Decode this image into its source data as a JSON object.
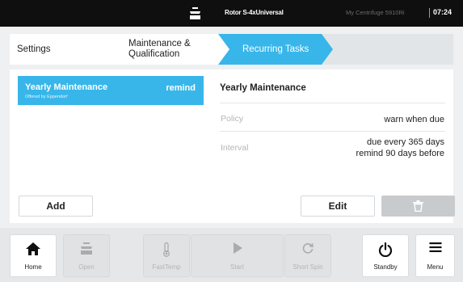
{
  "status_bar": {
    "icon": "rotor-icon",
    "rotor": "Rotor S-4xUniversal",
    "device": "My Centrifuge 5910Ri",
    "time": "07:24"
  },
  "breadcrumb": [
    {
      "label": "Settings"
    },
    {
      "label": "Maintenance &\nQualification"
    },
    {
      "label": "Recurring Tasks"
    }
  ],
  "task_list": {
    "items": [
      {
        "name": "Yearly Maintenance",
        "sub": "Offered by Eppendorf",
        "status": "remind"
      }
    ],
    "add_label": "Add"
  },
  "detail": {
    "title": "Yearly Maintenance",
    "rows": [
      {
        "label": "Policy",
        "value": "warn when due"
      },
      {
        "label": "Interval",
        "value": "due every 365 days\nremind 90 days before"
      }
    ],
    "edit_label": "Edit",
    "delete_icon": "trash-icon"
  },
  "nav": [
    {
      "label": "Home",
      "icon": "home-icon",
      "enabled": true
    },
    {
      "label": "Open",
      "icon": "open-lid-icon",
      "enabled": false
    },
    {
      "label": "FastTemp",
      "icon": "thermometer-icon",
      "enabled": false
    },
    {
      "label": "Start",
      "icon": "play-icon",
      "enabled": false
    },
    {
      "label": "Short Spin",
      "icon": "refresh-icon",
      "enabled": false
    },
    {
      "label": "Standby",
      "icon": "power-icon",
      "enabled": true
    },
    {
      "label": "Menu",
      "icon": "menu-icon",
      "enabled": true
    }
  ],
  "colors": {
    "accent": "#38b6ea",
    "topbar": "#0f0f10"
  }
}
